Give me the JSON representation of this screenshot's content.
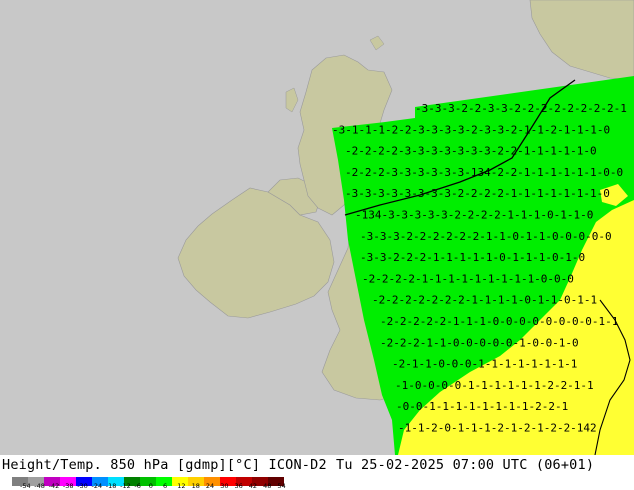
{
  "footer": {
    "title": "Height/Temp. 850 hPa [gdmp][°C] ICON-D2",
    "datetime": "Tu 25-02-2025 07:00 UTC (06+01)"
  },
  "legend": {
    "labels": [
      "-54",
      "-48",
      "-42",
      "-38",
      "-30",
      "-24",
      "-18",
      "-12",
      "-6",
      "0",
      "6",
      "12",
      "18",
      "24",
      "30",
      "36",
      "42",
      "48",
      "54"
    ],
    "colors": [
      "#7f7f7f",
      "#a0a0a0",
      "#c000c0",
      "#ff00ff",
      "#0000ff",
      "#0090ff",
      "#00e0ff",
      "#008000",
      "#00c000",
      "#00ff00",
      "#ffff00",
      "#ffd000",
      "#ff9000",
      "#ff0000",
      "#c00000",
      "#900000",
      "#600000"
    ]
  },
  "colors": {
    "sea": "#c8c8c8",
    "land": "#c8c8a0",
    "domain_green": "#00ee00",
    "warm_yellow": "#ffff33"
  },
  "map": {
    "grid_rows": [
      "-3-3-3-2-2-3-3-2-2-2-2-2-2-2-2-1",
      "-3-1-1-1-2-2-3-3-3-3-2-3-3-2-1-1-2-1-1-1-0",
      "-2-2-2-2-3-3-3-3-3-3-3-2-2-1-1-1-1-1-0",
      "-2-2-2-3-3-3-3-3-3-134-2-2-1-1-1-1-1-1-0-0",
      "-3-3-3-3-3-3-3-3-2-2-2-2-1-1-1-1-1-1-1-0",
      "-134-3-3-3-3-3-2-2-2-2-1-1-1-0-1-1-0",
      "-3-3-3-2-2-2-2-2-2-1-1-0-1-1-0-0-0-0-0",
      "-3-3-2-2-2-1-1-1-1-1-0-1-1-1-0-1-0",
      "-2-2-2-2-1-1-1-1-1-1-1-1-1-0-0-0",
      "-2-2-2-2-2-2-2-1-1-1-1-0-1-1-0-1-1",
      "-2-2-2-2-2-1-1-1-0-0-0-0-0-0-0-0-1-1",
      "-2-2-2-1-1-0-0-0-0-0-1-0-0-1-0",
      "-2-1-1-0-0-0-1-1-1-1-1-1-1-1",
      "-1-0-0-0-0-1-1-1-1-1-1-2-2-1-1",
      "-0-0-1-1-1-1-1-1-1-1-2-2-1",
      "-1-1-2-0-1-1-1-2-1-2-1-2-2-142"
    ]
  }
}
